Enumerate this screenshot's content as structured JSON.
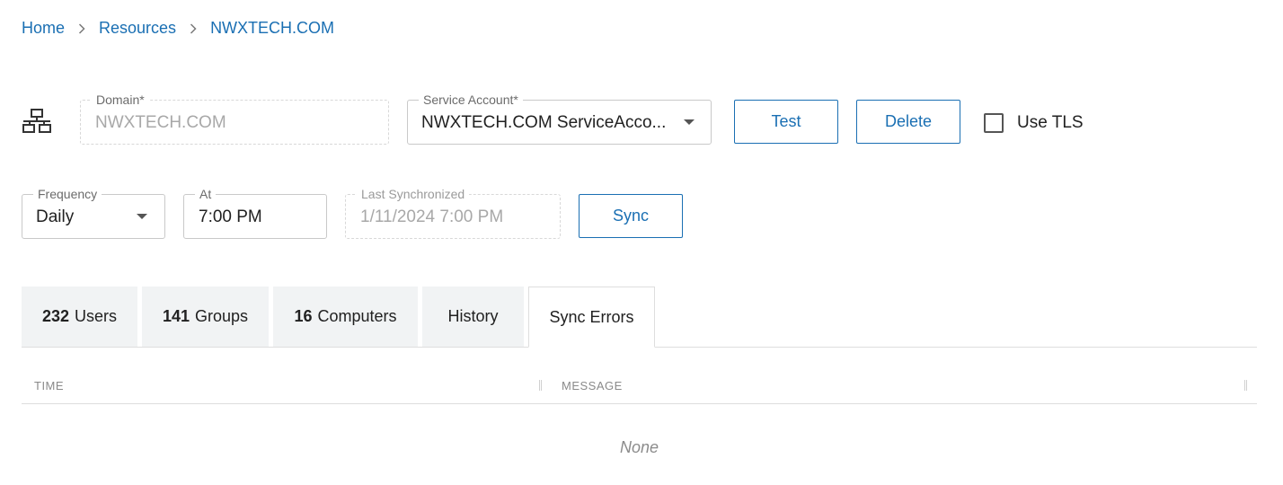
{
  "breadcrumb": {
    "items": [
      "Home",
      "Resources",
      "NWXTECH.COM"
    ]
  },
  "icons": {
    "domain": "network-tree-icon",
    "separator": "chevron-right-icon",
    "dropdown": "caret-down-icon"
  },
  "domain_field": {
    "label": "Domain*",
    "value": "NWXTECH.COM"
  },
  "service_account": {
    "label": "Service Account*",
    "value": "NWXTECH.COM ServiceAcco..."
  },
  "buttons": {
    "test": "Test",
    "delete": "Delete",
    "sync": "Sync"
  },
  "use_tls": {
    "label": "Use TLS",
    "checked": false
  },
  "frequency": {
    "label": "Frequency",
    "value": "Daily"
  },
  "at": {
    "label": "At",
    "value": "7:00 PM"
  },
  "last_sync": {
    "label": "Last Synchronized",
    "value": "1/11/2024 7:00 PM"
  },
  "tabs": [
    {
      "count": "232",
      "label": "Users"
    },
    {
      "count": "141",
      "label": "Groups"
    },
    {
      "count": "16",
      "label": "Computers"
    },
    {
      "count": "",
      "label": "History"
    },
    {
      "count": "",
      "label": "Sync Errors",
      "active": true
    }
  ],
  "grid": {
    "columns": [
      "TIME",
      "MESSAGE"
    ],
    "empty_text": "None"
  },
  "colors": {
    "accent": "#1a6fb3",
    "tab_bg": "#f1f3f4"
  }
}
